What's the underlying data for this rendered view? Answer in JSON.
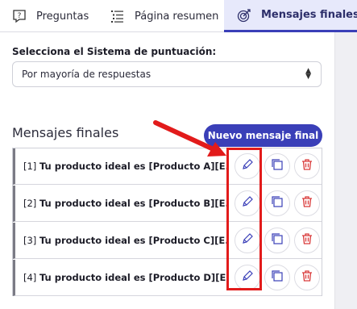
{
  "tabs": [
    {
      "label": "Preguntas",
      "icon": "question-icon"
    },
    {
      "label": "Página resumen",
      "icon": "list-icon"
    },
    {
      "label": "Mensajes finales",
      "icon": "target-icon",
      "active": true
    }
  ],
  "scoring": {
    "label": "Selecciona el Sistema de puntuación:",
    "selected": "Por mayoría de respuestas"
  },
  "final_messages": {
    "title": "Mensajes finales",
    "new_button": "Nuevo mensaje final",
    "items": [
      {
        "index": "[1]",
        "text": "Tu producto ideal es [Producto A][E..."
      },
      {
        "index": "[2]",
        "text": "Tu producto ideal es [Producto B][E..."
      },
      {
        "index": "[3]",
        "text": "Tu producto ideal es [Producto C][E..."
      },
      {
        "index": "[4]",
        "text": "Tu producto ideal es [Producto D][E..."
      }
    ]
  },
  "colors": {
    "accent": "#3a3fb8",
    "annotation": "#e21b1b",
    "delete": "#d93b3b"
  }
}
